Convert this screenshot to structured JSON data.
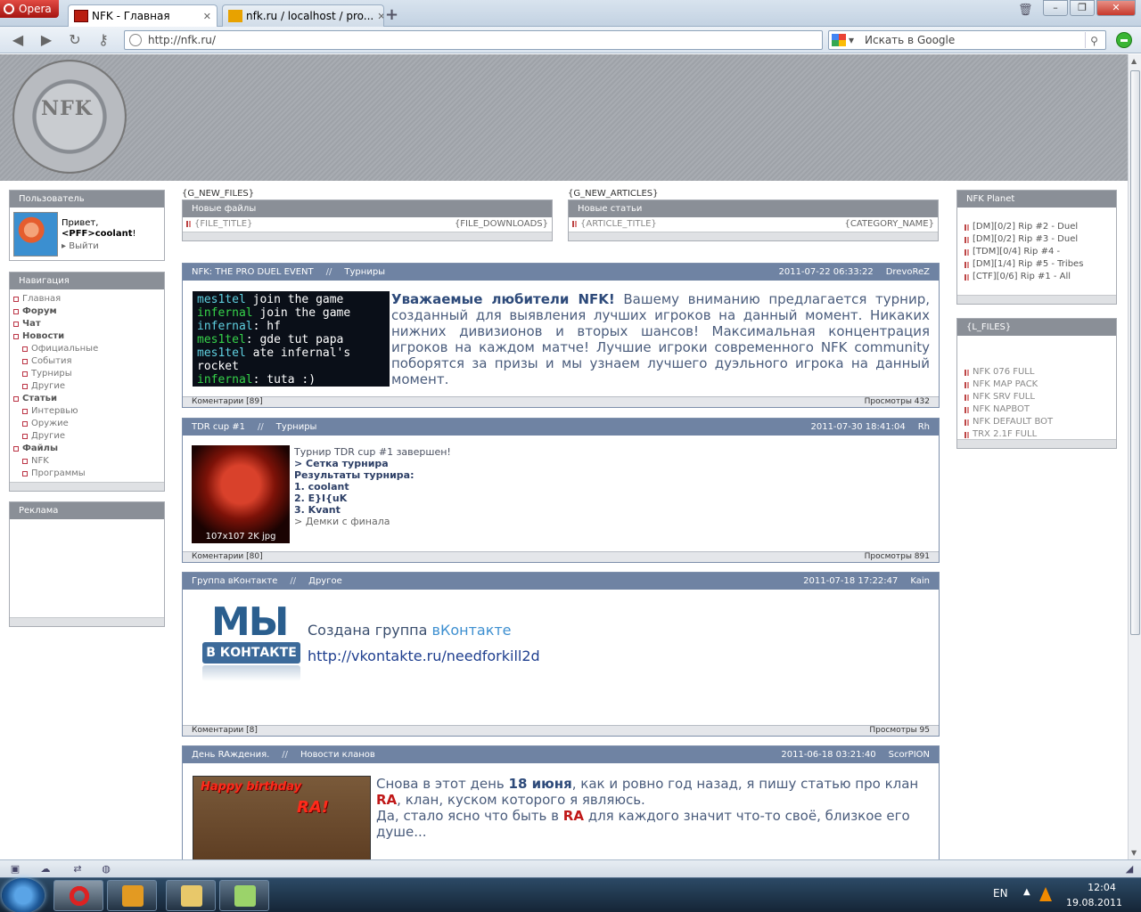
{
  "browser": {
    "menu_label": "Opera",
    "tabs": [
      {
        "label": "NFK - Главная"
      },
      {
        "label": "nfk.ru / localhost / pro..."
      }
    ],
    "address": "http://nfk.ru/",
    "search_placeholder": "Искать в Google"
  },
  "site": {
    "logo_text": "NFK",
    "user_box": {
      "title": "Пользователь",
      "greeting": "Привет,",
      "username": "<PFF>coolant",
      "exclaim": "!",
      "logout": "Выйти"
    },
    "nav_box": {
      "title": "Навигация",
      "items": [
        {
          "label": "Главная",
          "bold": false,
          "sub": false
        },
        {
          "label": "Форум",
          "bold": true,
          "sub": false
        },
        {
          "label": "Чат",
          "bold": true,
          "sub": false
        },
        {
          "label": "Новости",
          "bold": true,
          "sub": false
        },
        {
          "label": "Официальные",
          "bold": false,
          "sub": true
        },
        {
          "label": "События",
          "bold": false,
          "sub": true
        },
        {
          "label": "Турниры",
          "bold": false,
          "sub": true
        },
        {
          "label": "Другие",
          "bold": false,
          "sub": true
        },
        {
          "label": "Статьи",
          "bold": true,
          "sub": false
        },
        {
          "label": "Интервью",
          "bold": false,
          "sub": true
        },
        {
          "label": "Оружие",
          "bold": false,
          "sub": true
        },
        {
          "label": "Другие",
          "bold": false,
          "sub": true
        },
        {
          "label": "Файлы",
          "bold": true,
          "sub": false
        },
        {
          "label": "NFK",
          "bold": false,
          "sub": true
        },
        {
          "label": "Программы",
          "bold": false,
          "sub": true
        }
      ]
    },
    "ad_box": {
      "title": "Реклама"
    },
    "new_files": {
      "tpl_label": "{G_NEW_FILES}",
      "title": "Новые файлы",
      "item_title": "{FILE_TITLE}",
      "item_right": "{FILE_DOWNLOADS}"
    },
    "new_articles": {
      "tpl_label": "{G_NEW_ARTICLES}",
      "title": "Новые статьи",
      "item_title": "{ARTICLE_TITLE}",
      "item_right": "{CATEGORY_NAME}"
    },
    "planet_box": {
      "title": "NFK Planet",
      "items": [
        "[DM][0/2] Rip #2 - Duel",
        "[DM][0/2] Rip #3 - Duel",
        "[TDM][0/4] Rip #4 -",
        "[DM][1/4] Rip #5 - Tribes",
        "[CTF][0/6] Rip #1 - All"
      ]
    },
    "files_box": {
      "title": "{L_FILES}",
      "items": [
        "NFK 076 FULL",
        "NFK MAP PACK",
        "NFK SRV FULL",
        "NFK NAPBOT",
        "NFK DEFAULT BOT",
        "TRX 2.1F FULL"
      ]
    },
    "articles": [
      {
        "title": "NFK: THE PRO DUEL EVENT",
        "sep": "//",
        "category": "Турниры",
        "date": "2011-07-22 06:33:22",
        "author": "DrevoReZ",
        "comments": "Коментарии [89]",
        "views": "Просмотры 432",
        "image_lines": [
          {
            "name": "mes1tel",
            "msg": " join the game"
          },
          {
            "name": "infernal",
            "msg": " join the game"
          },
          {
            "name": "infernal",
            "msg": ": hf"
          },
          {
            "name": "mes1tel",
            "msg": ": gde tut papa"
          },
          {
            "name": "mes1tel",
            "msg": " ate infernal's rocket"
          },
          {
            "name": "infernal",
            "msg": ": tuta :)"
          },
          {
            "name": "",
            "msg": "]_"
          }
        ],
        "lead": "Уважаемые любители NFK!",
        "body": " Вашему вниманию предлагается турнир, созданный для выявления лучших игроков на данный момент. Никаких нижних дивизионов и вторых шансов! Максимальная концентрация игроков на каждом матче! Лучшие игроки современного NFK community поборятся за призы и мы узнаем лучшего дуэльного игрока на данный момент."
      },
      {
        "title": "TDR cup #1",
        "sep": "//",
        "category": "Турниры",
        "date": "2011-07-30 18:41:04",
        "author": "Rh",
        "comments": "Коментарии [80]",
        "views": "Просмотры 891",
        "image_caption": "107x107 2K jpg",
        "lines": [
          {
            "text": "Турнир TDR cup #1 завершен!",
            "style": "n"
          },
          {
            "text": "> Сетка турнира",
            "style": "b"
          },
          {
            "text": "Результаты турнира:",
            "style": "b"
          },
          {
            "text": "1. coolant",
            "style": "b"
          },
          {
            "text": "2. E}I{uK",
            "style": "b"
          },
          {
            "text": "3. Kvant",
            "style": "b"
          },
          {
            "text": "> Демки с финала",
            "style": "g"
          }
        ]
      },
      {
        "title": "Группа вКонтакте",
        "sep": "//",
        "category": "Другое",
        "date": "2011-07-18 17:22:47",
        "author": "Kain",
        "comments": "Коментарии [8]",
        "views": "Просмотры 95",
        "image_big": "МЫ",
        "image_badge": "В КОНТАКТЕ",
        "line1_prefix": "Создана группа ",
        "line1_link": "вКонтакте",
        "line2": "http://vkontakte.ru/needforkill2d"
      },
      {
        "title": "День RAждения.",
        "sep": "//",
        "category": "Новости кланов",
        "date": "2011-06-18 03:21:40",
        "author": "ScorPION",
        "image_text1": "Happy birthday",
        "image_text2": "RA!",
        "p1": "Снова в этот день ",
        "p1b": "18 июня",
        "p1c": ", как и ровно год назад, я пишу статью про клан ",
        "p1ra": "RA",
        "p1d": ", клан, куском которого я являюсь.",
        "p2": "Да, стало ясно что быть в ",
        "p2ra": "RA",
        "p2b": " для каждого значит что-то своё, близкое его душе..."
      }
    ]
  },
  "taskbar": {
    "lang": "EN",
    "time": "12:04",
    "date": "19.08.2011"
  }
}
